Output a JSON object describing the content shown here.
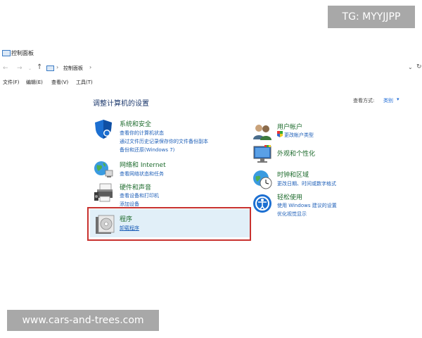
{
  "watermark": {
    "top": "TG: MYYJJPP",
    "bottom": "www.cars-and-trees.com"
  },
  "window": {
    "title": "控制面板"
  },
  "address": {
    "path": "控制面板"
  },
  "menu": {
    "file": "文件(F)",
    "edit": "编辑(E)",
    "view": "查看(V)",
    "tools": "工具(T)"
  },
  "main": {
    "heading": "调整计算机的设置",
    "view_by_label": "查看方式:",
    "view_by_value": "类别"
  },
  "categories": {
    "system": {
      "title": "系统和安全",
      "links": [
        "查看你的计算机状态",
        "通过文件历史记录保存你的文件备份副本",
        "备份和还原(Windows 7)"
      ]
    },
    "network": {
      "title": "网络和 Internet",
      "links": [
        "查看网络状态和任务"
      ]
    },
    "hardware": {
      "title": "硬件和声音",
      "links": [
        "查看设备和打印机",
        "添加设备"
      ]
    },
    "programs": {
      "title": "程序",
      "links": [
        "卸载程序"
      ]
    },
    "user": {
      "title": "用户帐户",
      "links": [
        "更改帐户类型"
      ]
    },
    "appearance": {
      "title": "外观和个性化",
      "links": []
    },
    "clock": {
      "title": "时钟和区域",
      "links": [
        "更改日期、时间或数字格式"
      ]
    },
    "ease": {
      "title": "轻松使用",
      "links": [
        "使用 Windows 建议的设置",
        "优化视觉显示"
      ]
    }
  },
  "colors": {
    "accent_link": "#1e5fb8",
    "category_title": "#1e6b2d",
    "highlight_border": "#c8322f",
    "highlight_bg": "#e1eff8"
  }
}
